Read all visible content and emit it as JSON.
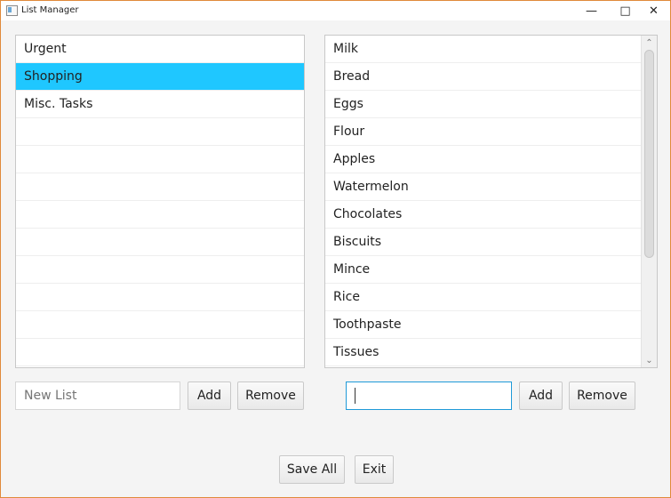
{
  "window": {
    "title": "List Manager",
    "controls": {
      "minimize": "—",
      "maximize": "□",
      "close": "✕"
    }
  },
  "lists": [
    "Urgent",
    "Shopping",
    "Misc. Tasks"
  ],
  "selected_list": "Shopping",
  "items": [
    "Milk",
    "Bread",
    "Eggs",
    "Flour",
    "Apples",
    "Watermelon",
    "Chocolates",
    "Biscuits",
    "Mince",
    "Rice",
    "Toothpaste",
    "Tissues"
  ],
  "left_controls": {
    "new_list_placeholder": "New List",
    "add_label": "Add",
    "remove_label": "Remove"
  },
  "right_controls": {
    "item_value": "",
    "add_label": "Add",
    "remove_label": "Remove"
  },
  "footer": {
    "save_all_label": "Save All",
    "exit_label": "Exit"
  },
  "colors": {
    "selection": "#1fc7ff",
    "focus_border": "#1f9ad8"
  },
  "scrollbar_icons": {
    "up": "⌃",
    "down": "⌄"
  }
}
